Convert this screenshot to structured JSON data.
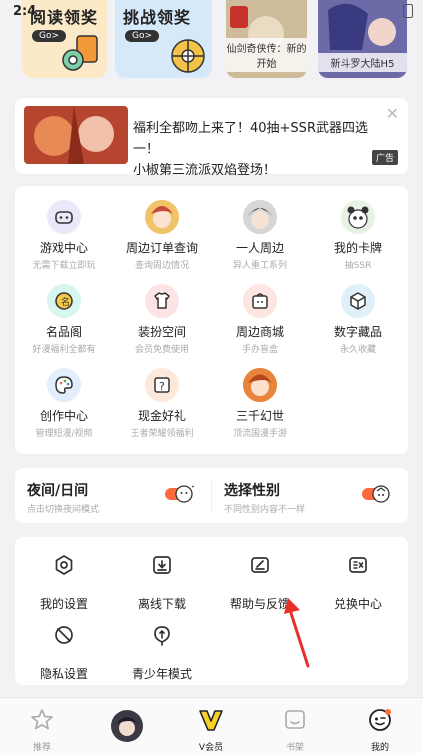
{
  "status": {
    "time": "2:4"
  },
  "promos": [
    {
      "title": "阅读领奖",
      "button": "Go>"
    },
    {
      "title": "挑战领奖",
      "button": "Go>"
    },
    {
      "caption": "仙剑奇侠传：新的开始"
    },
    {
      "caption": "新斗罗大陆H5"
    }
  ],
  "banner": {
    "line1": "福利全都吻上来了！40抽+SSR武器四选一！",
    "line2": "小椒第三流派双焰登场！",
    "ad_label": "广告"
  },
  "services": [
    {
      "label": "游戏中心",
      "sub": "无需下载立即玩",
      "icon": "gamepad-icon"
    },
    {
      "label": "周边订单查询",
      "sub": "查询周边情况",
      "icon": "avatar-icon"
    },
    {
      "label": "一人周边",
      "sub": "异人重工系列",
      "icon": "avatar-icon"
    },
    {
      "label": "我的卡牌",
      "sub": "抽SSR",
      "icon": "panda-icon"
    },
    {
      "label": "名品阁",
      "sub": "好漫福利全都有",
      "icon": "badge-icon"
    },
    {
      "label": "装扮空间",
      "sub": "会员免费使用",
      "icon": "shirt-icon"
    },
    {
      "label": "周边商城",
      "sub": "手办盲盒",
      "icon": "shop-icon"
    },
    {
      "label": "数字藏品",
      "sub": "永久收藏",
      "icon": "cube-icon"
    },
    {
      "label": "创作中心",
      "sub": "管理短漫/视频",
      "icon": "palette-icon"
    },
    {
      "label": "现金好礼",
      "sub": "王者荣耀领福利",
      "icon": "gift-box-icon"
    },
    {
      "label": "三千幻世",
      "sub": "顶流国漫手游",
      "icon": "avatar-icon"
    }
  ],
  "toggles": [
    {
      "title": "夜间/日间",
      "sub": "点击切换夜间模式"
    },
    {
      "title": "选择性别",
      "sub": "不同性别内容不一样"
    }
  ],
  "settings": [
    {
      "label": "我的设置",
      "icon": "settings-icon"
    },
    {
      "label": "离线下载",
      "icon": "download-icon"
    },
    {
      "label": "帮助与反馈",
      "icon": "feedback-icon"
    },
    {
      "label": "兑换中心",
      "icon": "exchange-icon"
    },
    {
      "label": "隐私设置",
      "icon": "privacy-icon"
    },
    {
      "label": "青少年模式",
      "icon": "youth-icon"
    }
  ],
  "nav": [
    {
      "label": "推荐",
      "icon": "star-icon"
    },
    {
      "label": "",
      "icon": "avatar-icon"
    },
    {
      "label": "V会员",
      "icon": "vip-icon"
    },
    {
      "label": "书架",
      "icon": "bookshelf-icon"
    },
    {
      "label": "我的",
      "icon": "profile-icon"
    }
  ],
  "colors": {
    "accent": "#ff6a3d",
    "toggle": "#ff6a3d",
    "arrow": "#e8302a"
  }
}
